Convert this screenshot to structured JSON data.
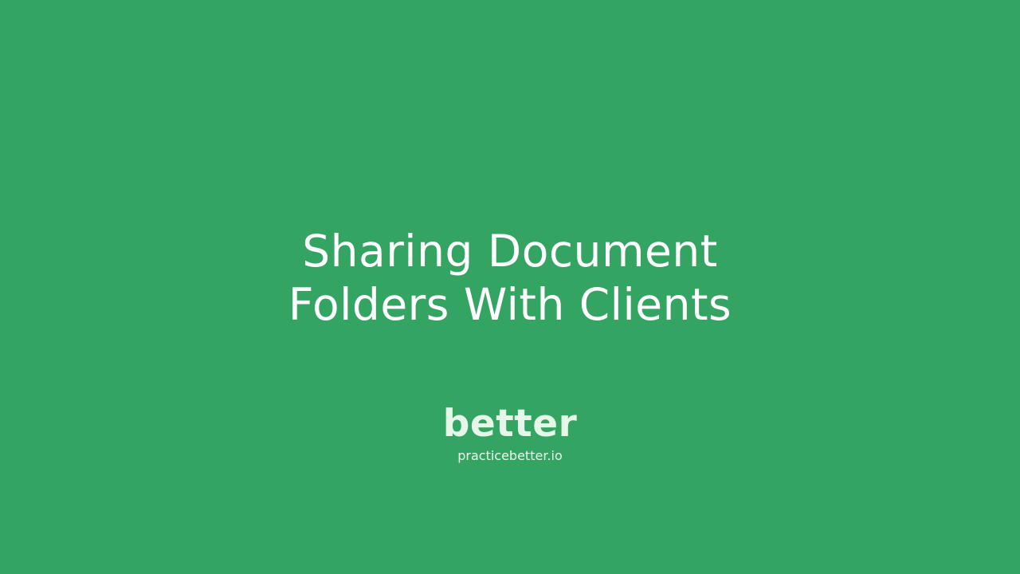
{
  "title": {
    "line1": "Sharing Document",
    "line2": "Folders With Clients"
  },
  "brand": {
    "wordmark": "better",
    "url": "practicebetter.io"
  },
  "colors": {
    "background": "#34a463",
    "title_text": "#ffffff",
    "wordmark": "#e6f7ea"
  }
}
